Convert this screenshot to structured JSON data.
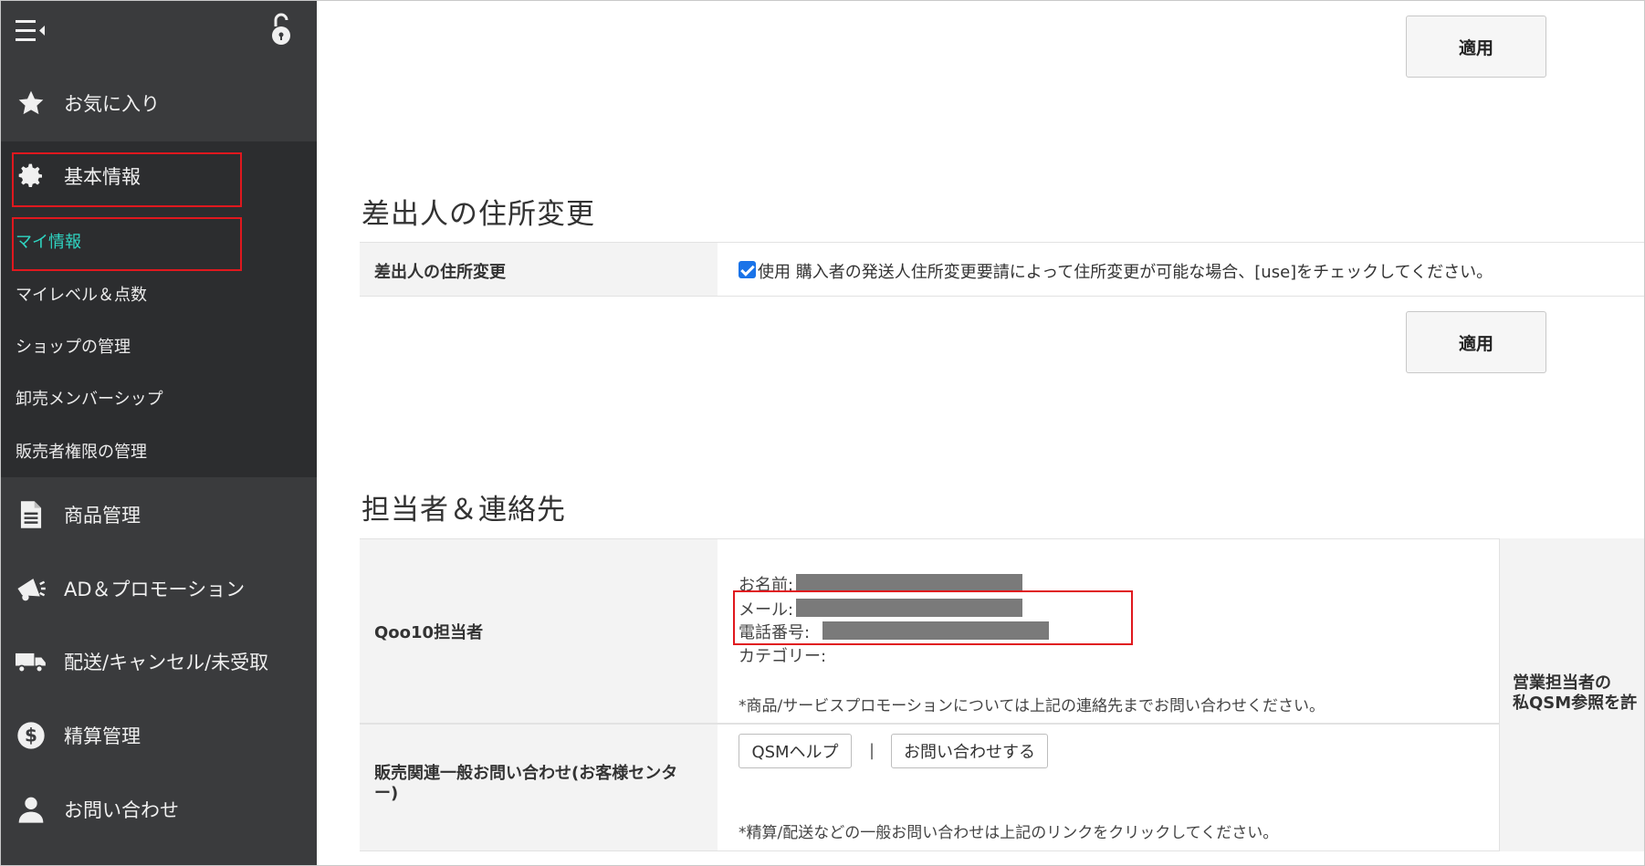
{
  "sidebar": {
    "hamburger_icon": "hamburger-collapse-icon",
    "lock_icon": "unlock-icon",
    "items": [
      {
        "label": "お気に入り",
        "icon": "star-icon"
      },
      {
        "label": "基本情報",
        "icon": "gear-icon"
      },
      {
        "label": "商品管理",
        "icon": "document-icon"
      },
      {
        "label": "AD＆プロモーション",
        "icon": "megaphone-icon"
      },
      {
        "label": "配送/キャンセル/未受取",
        "icon": "truck-icon"
      },
      {
        "label": "精算管理",
        "icon": "dollar-icon"
      },
      {
        "label": "お問い合わせ",
        "icon": "user-icon"
      }
    ],
    "sub_items": [
      {
        "label": "マイ情報",
        "active": true
      },
      {
        "label": "マイレベル＆点数"
      },
      {
        "label": "ショップの管理"
      },
      {
        "label": "卸売メンバーシップ"
      },
      {
        "label": "販売者権限の管理"
      }
    ]
  },
  "main": {
    "apply_label": "適用",
    "sender_section": {
      "title": "差出人の住所変更",
      "row_label": "差出人の住所変更",
      "checkbox_checked": true,
      "checkbox_text": "使用 購入者の発送人住所変更要請によって住所変更が可能な場合、[use]をチェックしてください。"
    },
    "contact_section": {
      "title": "担当者＆連絡先",
      "qoo10_row": {
        "label": "Qoo10担当者",
        "name_label": "お名前:",
        "mail_label": "メール:",
        "phone_label": "電話番号:",
        "category_label": "カテゴリー:",
        "note": "*商品/サービスプロモーションについては上記の連絡先までお問い合わせください。"
      },
      "side_label_line1": "営業担当者の",
      "side_label_line2": "私QSM参照を許",
      "general_row": {
        "label_line1": "販売関連一般お問い合わせ(お客様センタ",
        "label_line2": "ー)",
        "qsm_help": "QSMヘルプ",
        "separator": "|",
        "contact_button": "お問い合わせする",
        "note": "*精算/配送などの一般お問い合わせは上記のリンクをクリックしてください。"
      }
    }
  }
}
